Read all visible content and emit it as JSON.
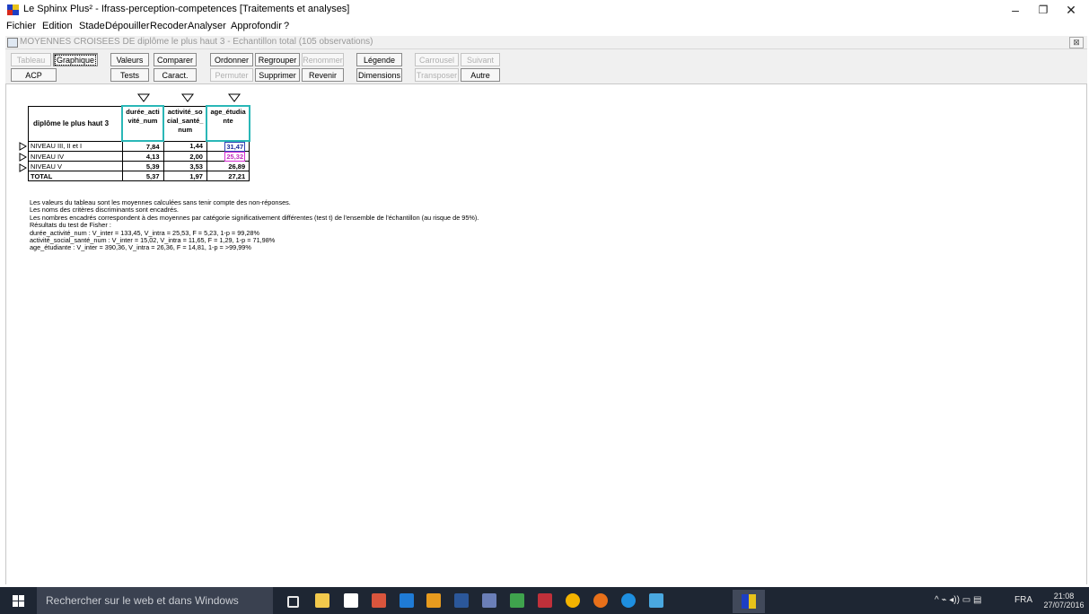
{
  "window": {
    "title": "Le Sphinx Plus² - Ifrass-perception-competences [Traitements et analyses]",
    "controls": [
      "–",
      "❐",
      "✕"
    ]
  },
  "menu": [
    "Fichier",
    "Edition",
    "Stade",
    "Dépouiller",
    "Recoder",
    "Analyser",
    "Approfondir",
    "?"
  ],
  "child_window": {
    "title": "MOYENNES CROISEES DE diplôme le plus haut 3 - Echantillon total (105 observations)",
    "close": "⊠"
  },
  "toolbar": {
    "row1": [
      "Tableau",
      "Graphique",
      "Valeurs",
      "Comparer",
      "Ordonner",
      "Regrouper",
      "Renommer",
      "Légende",
      "Carrousel",
      "Suivant"
    ],
    "row2": [
      "ACP",
      "Tests",
      "Caract.",
      "Permuter",
      "Supprimer",
      "Revenir",
      "Dimensions",
      "Transposer",
      "Autre"
    ]
  },
  "table": {
    "corner": "diplôme le plus haut 3",
    "headers": [
      "durée_acti vité_num",
      "activité_so cial_santé_ num",
      "age_étudia nte"
    ],
    "rows": [
      {
        "label": "NIVEAU III, II et I",
        "v1": "7,84",
        "v2": "1,44",
        "v3": "31,47"
      },
      {
        "label": "NIVEAU IV",
        "v1": "4,13",
        "v2": "2,00",
        "v3": "25,32"
      },
      {
        "label": "NIVEAU V",
        "v1": "5,39",
        "v2": "3,53",
        "v3": "26,89"
      }
    ],
    "total": {
      "label": "TOTAL",
      "v1": "5,37",
      "v2": "1,97",
      "v3": "27,21"
    }
  },
  "notes": [
    "Les valeurs du tableau sont les moyennes calculées sans tenir compte des non-réponses.",
    "Les noms des critères discriminants sont encadrés.",
    "Les nombres encadrés correspondent à des moyennes par catégorie significativement différentes (test t) de l'ensemble de l'échantillon (au risque de 95%).",
    "Résultats du test de Fisher :",
    "durée_activité_num : V_inter = 133,45, V_intra = 25,53, F = 5,23, 1-p = 99,28%",
    "activité_social_santé_num : V_inter = 15,02, V_intra = 11,65, F = 1,29, 1-p = 71,98%",
    "age_étudiante : V_inter = 390,36, V_intra = 26,36, F = 14,81, 1-p = >99,99%"
  ],
  "taskbar": {
    "search_placeholder": "Rechercher sur le web et dans Windows",
    "language": "FRA",
    "time": "21:08",
    "date": "27/07/2016",
    "tray_icons": "^ ⌁ ◂)) ▭ ▤"
  }
}
